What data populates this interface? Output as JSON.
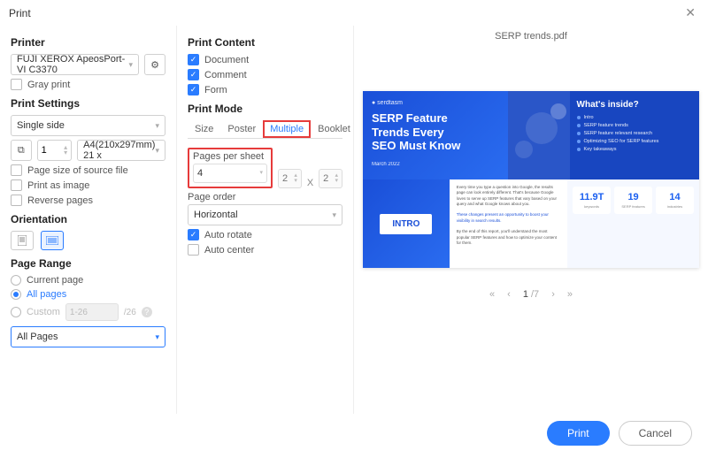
{
  "title": "Print",
  "printer": {
    "label": "Printer",
    "selected": "FUJI XEROX ApeosPort-VI C3370",
    "gray_print": "Gray print"
  },
  "settings": {
    "label": "Print Settings",
    "side": "Single side",
    "copies": "1",
    "paper": "A4(210x297mm) 21 x",
    "source_file": "Page size of source file",
    "as_image": "Print as image",
    "reverse": "Reverse pages"
  },
  "orientation": {
    "label": "Orientation"
  },
  "range": {
    "label": "Page Range",
    "current": "Current page",
    "all": "All pages",
    "custom": "Custom",
    "custom_placeholder": "1-26",
    "custom_total": "/26",
    "select": "All Pages"
  },
  "content": {
    "label": "Print Content",
    "document": "Document",
    "comment": "Comment",
    "form": "Form"
  },
  "mode": {
    "label": "Print Mode",
    "tabs": {
      "size": "Size",
      "poster": "Poster",
      "multiple": "Multiple",
      "booklet": "Booklet"
    },
    "pps_label": "Pages per sheet",
    "pps_value": "4",
    "dim1": "2",
    "dim_x": "X",
    "dim2": "2",
    "order_label": "Page order",
    "order_value": "Horizontal",
    "auto_rotate": "Auto rotate",
    "auto_center": "Auto center"
  },
  "preview": {
    "filename": "SERP trends.pdf",
    "slide1": {
      "brand": "● serdtasm",
      "heading_l1": "SERP Feature",
      "heading_l2": "Trends Every",
      "heading_l3": "SEO Must Know",
      "date": "March 2022"
    },
    "slide2": {
      "title": "What's inside?",
      "items": [
        "Intro",
        "SERP feature trends",
        "SERP feature relevant research",
        "Optimizing SEO for SERP features",
        "Key takeaways"
      ]
    },
    "slide3": {
      "intro": "INTRO"
    },
    "slide4": {
      "stats": [
        {
          "n": "11.9T",
          "l": "keywords"
        },
        {
          "n": "19",
          "l": "SERP features"
        },
        {
          "n": "14",
          "l": "industries"
        }
      ]
    }
  },
  "pager": {
    "first": "«",
    "prev": "‹",
    "page": "1",
    "total": "/7",
    "next": "›",
    "last": "»"
  },
  "footer": {
    "print": "Print",
    "cancel": "Cancel"
  }
}
